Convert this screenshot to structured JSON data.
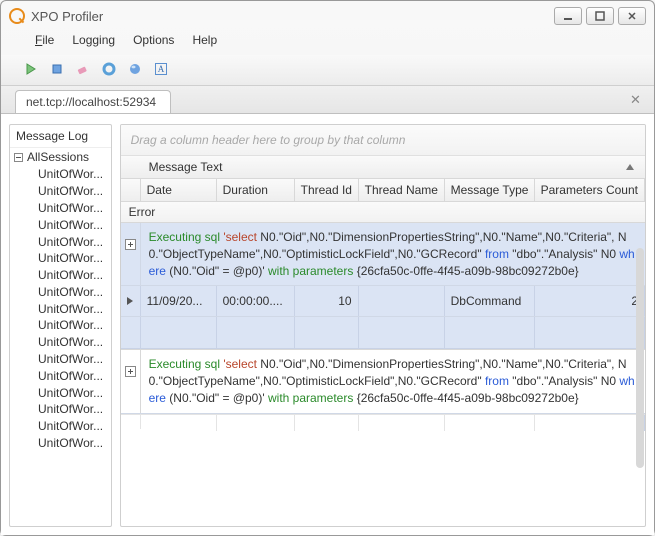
{
  "window": {
    "title": "XPO Profiler"
  },
  "menu": {
    "file": "File",
    "logging": "Logging",
    "options": "Options",
    "help": "Help"
  },
  "toolbar_icons": [
    "play",
    "stop",
    "eraser",
    "donut",
    "sphere",
    "text-a"
  ],
  "tab": {
    "label": "net.tcp://localhost:52934"
  },
  "tree": {
    "root": "Message Log",
    "session": "AllSessions",
    "items": [
      "UnitOfWor...",
      "UnitOfWor...",
      "UnitOfWor...",
      "UnitOfWor...",
      "UnitOfWor...",
      "UnitOfWor...",
      "UnitOfWor...",
      "UnitOfWor...",
      "UnitOfWor...",
      "UnitOfWor...",
      "UnitOfWor...",
      "UnitOfWor...",
      "UnitOfWor...",
      "UnitOfWor...",
      "UnitOfWor...",
      "UnitOfWor...",
      "UnitOfWor..."
    ]
  },
  "grid": {
    "group_hint": "Drag a column header here to group by that column",
    "message_text_header": "Message Text",
    "columns": [
      "Date",
      "Duration",
      "Thread Id",
      "Thread Name",
      "Message Type",
      "Parameters Count"
    ],
    "error_label": "Error",
    "rows": [
      {
        "msg": {
          "prefix": "Executing sql",
          "sql_open": "'select",
          "body1": " N0.\"Oid\",N0.\"DimensionPropertiesString\",N0.\"Name\",N0.\"Criteria\", N0.\"ObjectTypeName\",N0.\"OptimisticLockField\",N0.\"GCRecord\" ",
          "from": "from",
          "body2": " \"dbo\".\"Analysis\" N0 ",
          "where": "where",
          "body3": " (N0.\"Oid\" = @p0)' ",
          "params": "with parameters",
          "guid": " {26cfa50c-0ffe-4f45-a09b-98bc09272b0e}"
        },
        "date": "11/09/20...",
        "duration": "00:00:00....",
        "thread_id": "10",
        "thread_name": "",
        "message_type": "DbCommand",
        "params_count": "2"
      },
      {
        "msg": {
          "prefix": "Executing sql",
          "sql_open": "'select",
          "body1": " N0.\"Oid\",N0.\"DimensionPropertiesString\",N0.\"Name\",N0.\"Criteria\", N0.\"ObjectTypeName\",N0.\"OptimisticLockField\",N0.\"GCRecord\" ",
          "from": "from",
          "body2": " \"dbo\".\"Analysis\" N0 ",
          "where": "where",
          "body3": " (N0.\"Oid\" = @p0)' ",
          "params": "with parameters",
          "guid": " {26cfa50c-0ffe-4f45-a09b-98bc09272b0e}"
        }
      }
    ]
  }
}
